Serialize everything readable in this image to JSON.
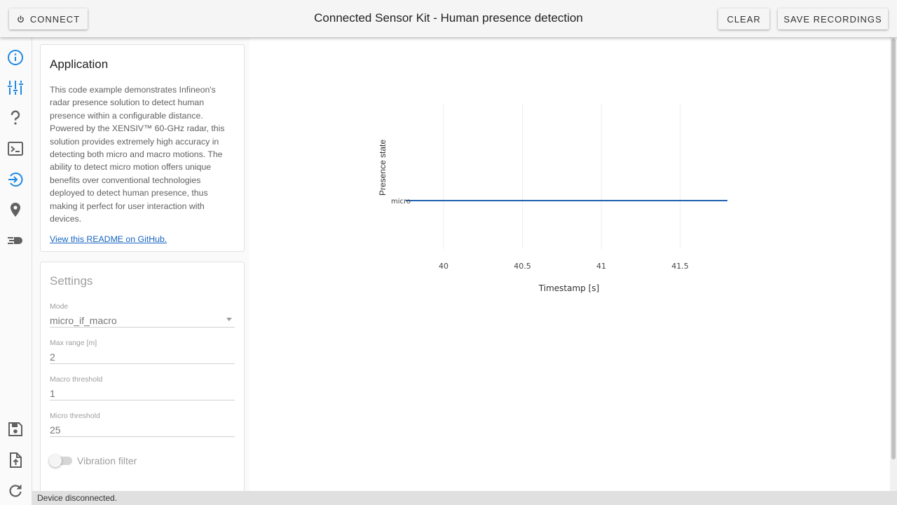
{
  "header": {
    "connect_label": "CONNECT",
    "title": "Connected Sensor Kit - Human presence detection",
    "clear_label": "CLEAR",
    "save_label": "SAVE RECORDINGS"
  },
  "nav": {
    "items": [
      {
        "name": "info-icon"
      },
      {
        "name": "sliders-icon"
      },
      {
        "name": "help-icon"
      },
      {
        "name": "terminal-icon"
      },
      {
        "name": "login-icon"
      },
      {
        "name": "location-pin-icon"
      },
      {
        "name": "speed-icon"
      },
      {
        "name": "save-icon"
      },
      {
        "name": "upload-file-icon"
      },
      {
        "name": "refresh-icon"
      }
    ],
    "accent": "#1e88e5",
    "icon_color": "#616161"
  },
  "application": {
    "title": "Application",
    "body": "This code example demonstrates Infineon's radar presence solution to detect human presence within a configurable distance. Powered by the XENSIV™ 60-GHz radar, this solution provides extremely high accuracy in detecting both micro and macro motions. The ability to detect micro motion offers unique benefits over conventional technologies deployed to detect human presence, thus making it perfect for user interaction with devices.",
    "link": "View this README on GitHub."
  },
  "settings": {
    "title": "Settings",
    "mode_label": "Mode",
    "mode_value": "micro_if_macro",
    "max_range_label": "Max range [m]",
    "max_range_value": "2",
    "macro_threshold_label": "Macro threshold",
    "macro_threshold_value": "1",
    "micro_threshold_label": "Micro threshold",
    "micro_threshold_value": "25",
    "vibration_filter_label": "Vibration filter",
    "vibration_filter_on": false
  },
  "chart_data": {
    "type": "line",
    "xlabel": "Timestamp [s]",
    "ylabel": "Presence state",
    "x_ticks": [
      40,
      40.5,
      41,
      41.5
    ],
    "xlim": [
      39.8,
      41.8
    ],
    "y_categories": [
      "micro"
    ],
    "series": [
      {
        "x": [
          39.76,
          41.8
        ],
        "y": [
          "micro",
          "micro"
        ],
        "color": "#1f5fae"
      }
    ],
    "grid": true
  },
  "status": {
    "text": "Device disconnected."
  }
}
